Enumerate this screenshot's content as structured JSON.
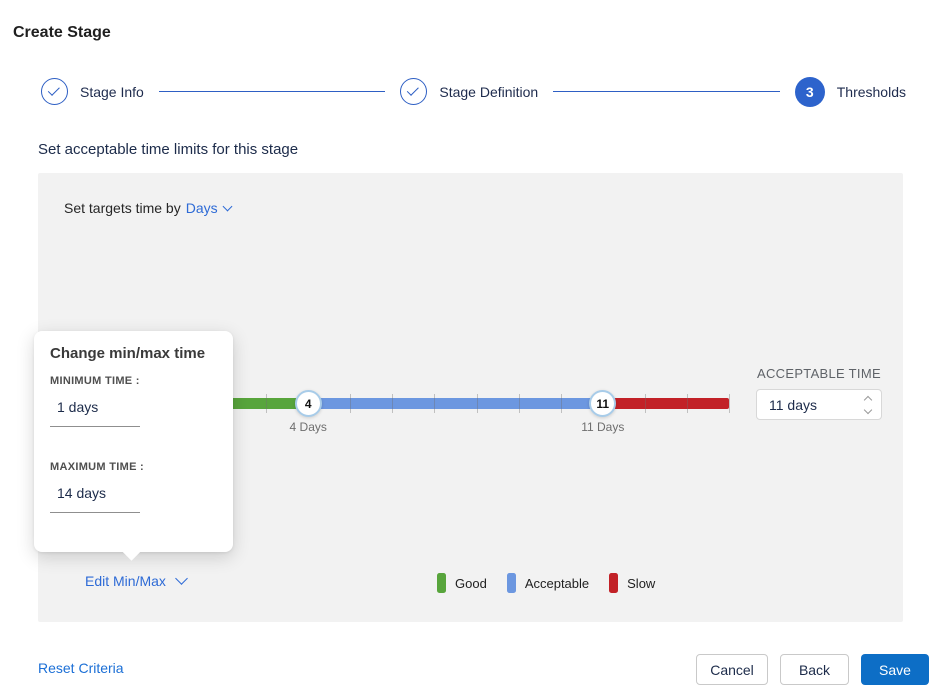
{
  "page": {
    "title": "Create Stage"
  },
  "stepper": {
    "steps": [
      {
        "label": "Stage Info",
        "state": "complete"
      },
      {
        "label": "Stage Definition",
        "state": "complete"
      },
      {
        "label": "Thresholds",
        "state": "active",
        "number": "3"
      }
    ]
  },
  "section": {
    "heading": "Set acceptable time limits for this stage"
  },
  "panel": {
    "targets_label": "Set targets time by",
    "targets_value": "Days",
    "acceptable_time_label": "ACCEPTABLE TIME",
    "acceptable_time_value": "11 days",
    "edit_minmax_label": "Edit Min/Max",
    "legend": [
      {
        "label": "Good",
        "color": "#58a53c"
      },
      {
        "label": "Acceptable",
        "color": "#6c97e0"
      },
      {
        "label": "Slow",
        "color": "#c22127"
      }
    ]
  },
  "popup": {
    "title": "Change min/max time",
    "minimum_label": "MINIMUM TIME :",
    "minimum_value": "1 days",
    "maximum_label": "MAXIMUM TIME :",
    "maximum_value": "14 days"
  },
  "slider": {
    "min_day": 1,
    "max_day": 14,
    "good_end_day": 4,
    "acceptable_end_day": 11,
    "handles": [
      {
        "day": 4,
        "value": "4",
        "label": "4 Days"
      },
      {
        "day": 11,
        "value": "11",
        "label": "11 Days"
      }
    ],
    "colors": {
      "good": "#58a53c",
      "acceptable": "#6c97e0",
      "slow": "#c22127"
    }
  },
  "footer": {
    "reset_label": "Reset Criteria",
    "cancel_label": "Cancel",
    "back_label": "Back",
    "save_label": "Save"
  }
}
